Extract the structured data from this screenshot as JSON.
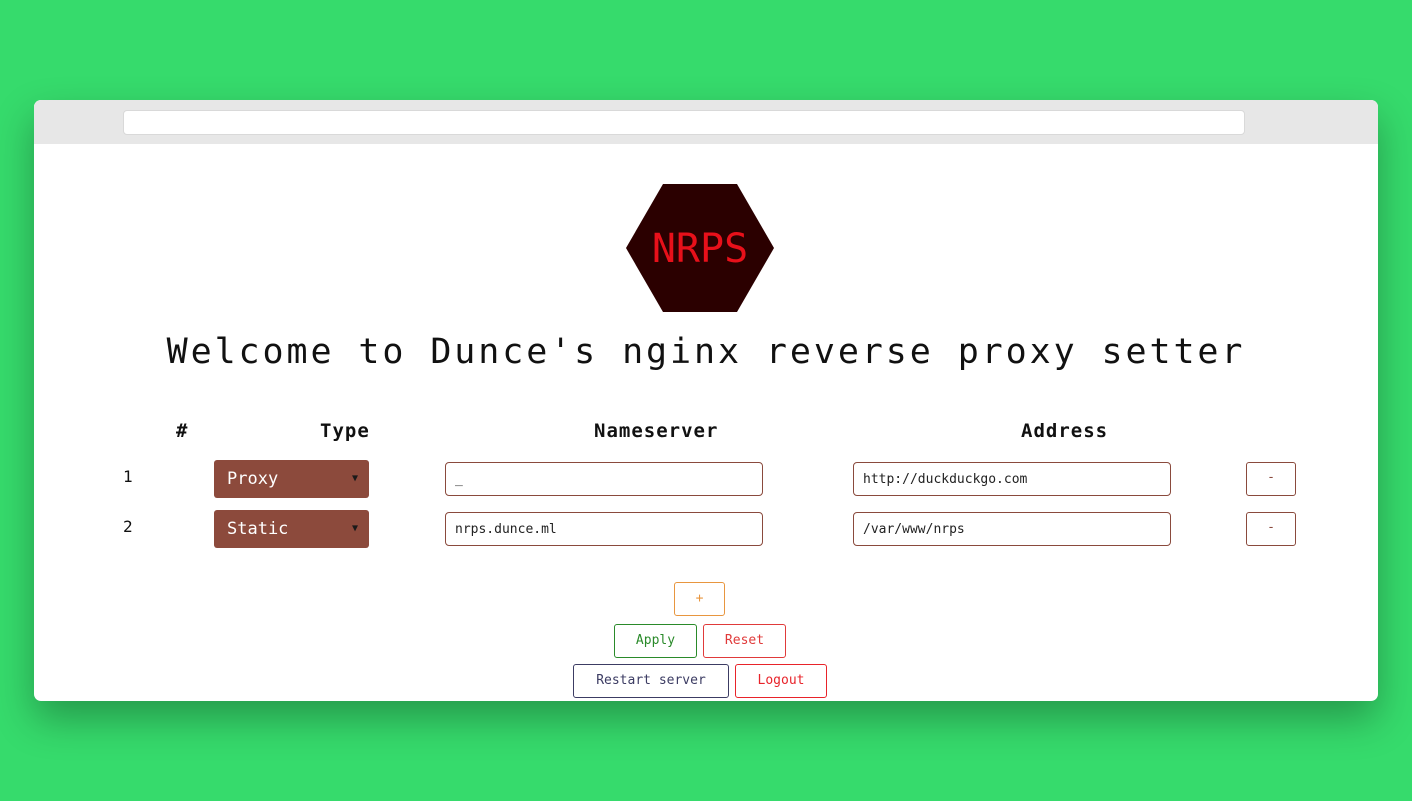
{
  "logo": {
    "text": "NRPS",
    "bg_color": "#2b0000",
    "text_color": "#e8101a"
  },
  "welcome_title": "Welcome to Dunce's nginx reverse proxy setter",
  "table": {
    "headers": {
      "number": "#",
      "type": "Type",
      "nameserver": "Nameserver",
      "address": "Address"
    },
    "rows": [
      {
        "number": "1",
        "type": "Proxy",
        "nameserver": "_",
        "address": "http://duckduckgo.com",
        "remove_label": "-"
      },
      {
        "number": "2",
        "type": "Static",
        "nameserver": "nrps.dunce.ml",
        "address": "/var/www/nrps",
        "remove_label": "-"
      }
    ]
  },
  "buttons": {
    "add": "+",
    "apply": "Apply",
    "reset": "Reset",
    "restart": "Restart server",
    "logout": "Logout"
  },
  "colors": {
    "background": "#36db6c",
    "select_bg": "#8c4a3c",
    "apply": "#2a8a2a",
    "reset": "#e03a3a",
    "add": "#e8963f",
    "restart": "#3c3c63",
    "logout": "#e8232a"
  }
}
